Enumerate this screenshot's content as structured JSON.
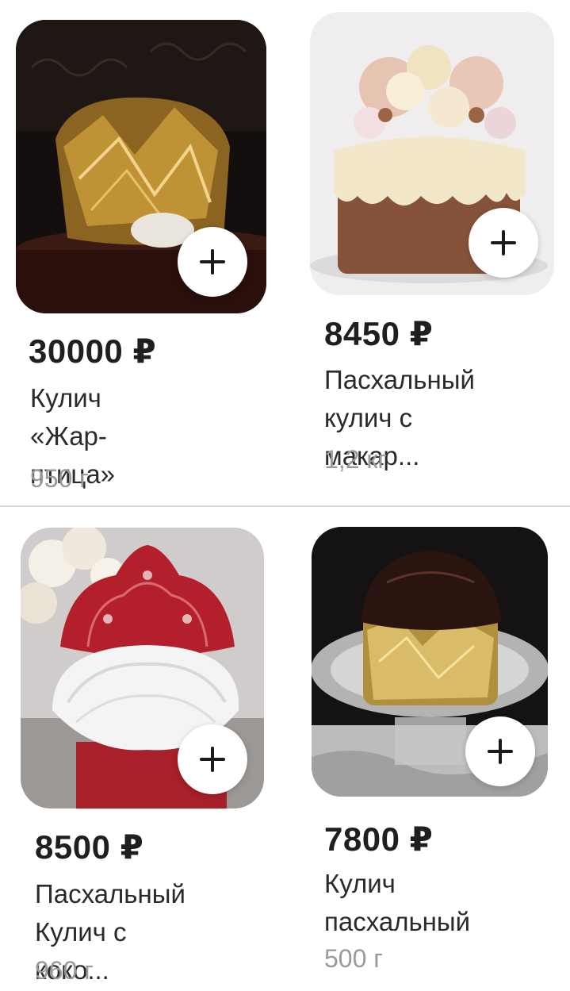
{
  "products": [
    {
      "price": "30000 ₽",
      "name_line1": "Кулич «Жар-",
      "name_line2": "птица»",
      "weight": "950 г",
      "add_label": "+"
    },
    {
      "price": "8450 ₽",
      "name_line1": "Пасхальный",
      "name_line2": "кулич с макар...",
      "weight": "1,2 кг",
      "add_label": "+"
    },
    {
      "price": "8500 ₽",
      "name_line1": "Пасхальный",
      "name_line2": "Кулич с коко...",
      "weight": "960 г",
      "add_label": "+"
    },
    {
      "price": "7800 ₽",
      "name_line1": "Кулич",
      "name_line2": "пасхальный",
      "weight": "500 г",
      "add_label": "+"
    }
  ],
  "icons": {
    "add": "plus-icon"
  }
}
